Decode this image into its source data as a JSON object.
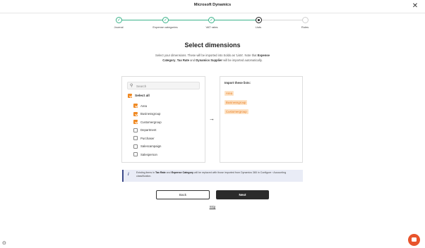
{
  "window": {
    "title": "Microsoft Dynamics",
    "close_icon": "close-icon"
  },
  "stepper": {
    "steps": [
      {
        "label": "Journal",
        "state": "done"
      },
      {
        "label": "Expense categories",
        "state": "done"
      },
      {
        "label": "VAT rates",
        "state": "done"
      },
      {
        "label": "Lists",
        "state": "current"
      },
      {
        "label": "Rules",
        "state": "todo"
      }
    ],
    "done_color": "#3bb38a"
  },
  "page": {
    "title": "Select dimensions",
    "description_part1": "Select your dimensions. These will be imported into Soldo as 'Lists'. Note that ",
    "expense_category": "Expense Category",
    "comma": ", ",
    "tax_rate": "Tax Rate",
    "and": " and ",
    "dynamics_supplier": "Dynamics Supplier",
    "description_part2": " will be imported automatically."
  },
  "left_panel": {
    "search_placeholder": "Search",
    "select_all_label": "Select all",
    "items": [
      {
        "label": "Area",
        "checked": true
      },
      {
        "label": "Businessgroup",
        "checked": true
      },
      {
        "label": "Customergroup",
        "checked": true
      },
      {
        "label": "Department",
        "checked": false
      },
      {
        "label": "Purchaser",
        "checked": false
      },
      {
        "label": "Salescampaign",
        "checked": false
      },
      {
        "label": "Salesperson",
        "checked": false
      }
    ]
  },
  "arrow": "→",
  "right_panel": {
    "title": "Import these lists:",
    "lists": [
      "Area",
      "Businessgroup",
      "Customergroup"
    ]
  },
  "info": {
    "icon": "i",
    "text_part1": "Existing items in ",
    "tax_rate": "Tax Rate",
    "and": " and ",
    "expense_category": "Expense Category",
    "text_part2": " will be replaced with those imported from Dynamics 365 in Configure › Accounting classification."
  },
  "buttons": {
    "back": "Back",
    "next": "Next",
    "skip": "Skip"
  },
  "colors": {
    "accent": "#f08a24",
    "tag_bg": "#fde3c6",
    "chat": "#e8542c",
    "info_border": "#3c4a8a"
  }
}
